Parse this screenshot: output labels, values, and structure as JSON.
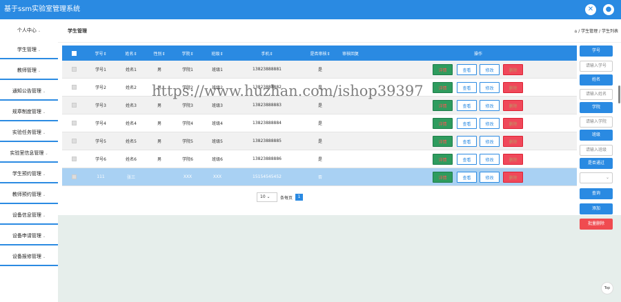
{
  "app": {
    "title": "基于ssm实验室管理系统",
    "accent": "#2a8ae2"
  },
  "topbar": {
    "icon1": "close-icon",
    "icon2": "user-icon"
  },
  "sidebar": {
    "items": [
      {
        "label": "个人中心"
      },
      {
        "label": "学生管理"
      },
      {
        "label": "教师管理"
      },
      {
        "label": "通知公告管理"
      },
      {
        "label": "规章制度管理"
      },
      {
        "label": "实验任务管理"
      },
      {
        "label": "实验室信息管理"
      },
      {
        "label": "学生预约管理"
      },
      {
        "label": "教师预约管理"
      },
      {
        "label": "设备信息管理"
      },
      {
        "label": "设备申请管理"
      },
      {
        "label": "设备报修管理"
      }
    ]
  },
  "header": {
    "page_title": "学生管理",
    "breadcrumb": "⌂ / 学生管理 / 学生列表"
  },
  "table": {
    "columns": [
      "学号⇕",
      "姓名⇕",
      "性别⇕",
      "学院⇕",
      "班级⇕",
      "手机⇕",
      "是否审核⇕",
      "审核回复",
      "操作"
    ],
    "action_labels": {
      "detail": "详情",
      "view": "查看",
      "edit": "修改",
      "delete": "删除"
    },
    "rows": [
      {
        "id": "学号1",
        "name": "姓名1",
        "gender": "男",
        "college": "学院1",
        "cls": "班级1",
        "phone": "13823888881",
        "approved": "是",
        "reply": ""
      },
      {
        "id": "学号2",
        "name": "姓名2",
        "gender": "男",
        "college": "学院2",
        "cls": "班级2",
        "phone": "13823888882",
        "approved": "是",
        "reply": ""
      },
      {
        "id": "学号3",
        "name": "姓名3",
        "gender": "男",
        "college": "学院3",
        "cls": "班级3",
        "phone": "13823888883",
        "approved": "是",
        "reply": ""
      },
      {
        "id": "学号4",
        "name": "姓名4",
        "gender": "男",
        "college": "学院4",
        "cls": "班级4",
        "phone": "13823888884",
        "approved": "是",
        "reply": ""
      },
      {
        "id": "学号5",
        "name": "姓名5",
        "gender": "男",
        "college": "学院5",
        "cls": "班级5",
        "phone": "13823888885",
        "approved": "是",
        "reply": ""
      },
      {
        "id": "学号6",
        "name": "姓名6",
        "gender": "男",
        "college": "学院6",
        "cls": "班级6",
        "phone": "13823888886",
        "approved": "是",
        "reply": ""
      },
      {
        "id": "111",
        "name": "张三",
        "gender": "",
        "college": "XXX",
        "cls": "XXX",
        "phone": "15154545452",
        "approved": "否",
        "reply": ""
      }
    ]
  },
  "pager": {
    "page_size": "10",
    "per_page_label": "条每页",
    "current_page": "1"
  },
  "search": {
    "student_id_label": "学号",
    "student_id_placeholder": "请输入学号",
    "name_label": "姓名",
    "name_placeholder": "请输入姓名",
    "college_label": "学院",
    "college_placeholder": "请输入学院",
    "class_label": "班级",
    "class_placeholder": "请输入班级",
    "approved_label": "是否通过",
    "approved_select": "",
    "query_button": "查询",
    "add_button": "添加",
    "batch_delete_button": "批量删除"
  },
  "watermark": "https://www.huzhan.com/ishop39397",
  "top_button": "Top"
}
